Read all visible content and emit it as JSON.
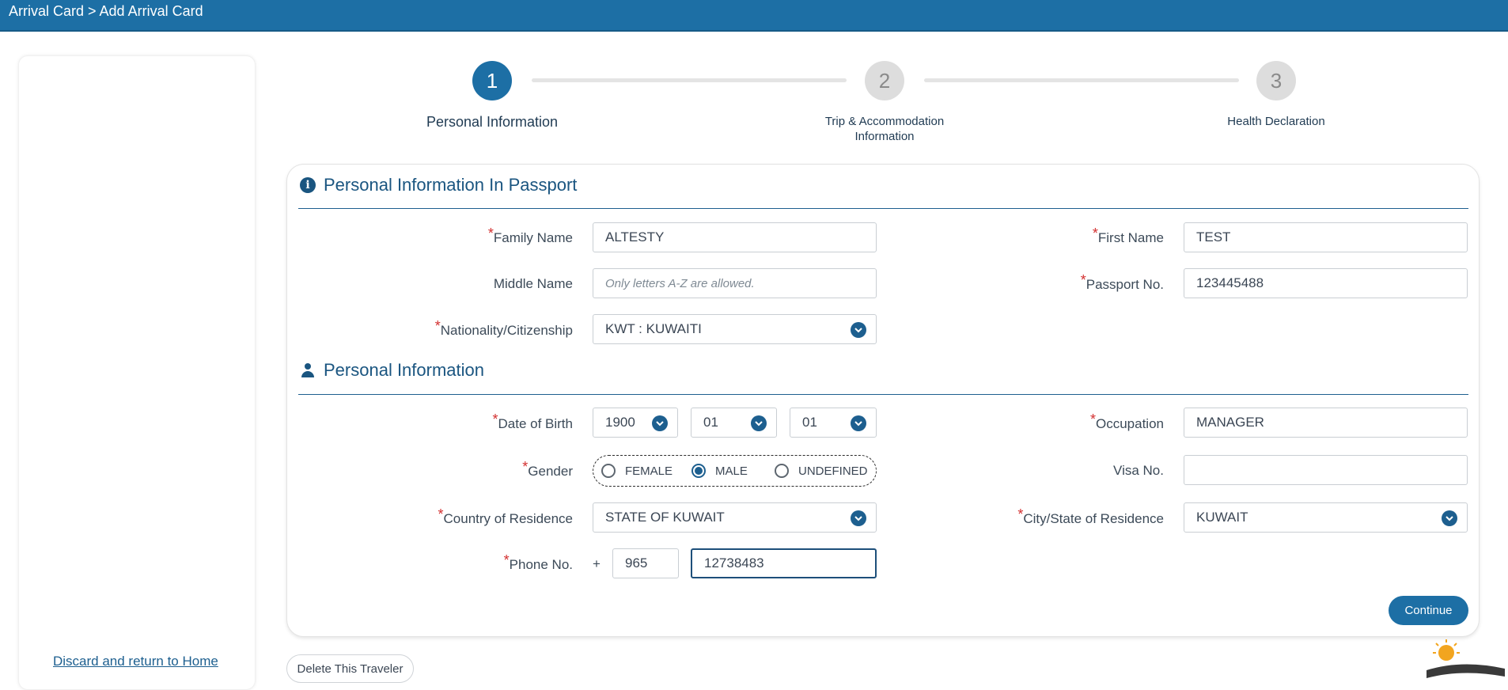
{
  "header": {
    "breadcrumb": "Arrival Card > Add Arrival Card"
  },
  "sidebar": {
    "discard_link": "Discard and return to Home"
  },
  "stepper": {
    "steps": [
      {
        "number": "1",
        "label": "Personal Information",
        "active": true
      },
      {
        "number": "2",
        "label_line1": "Trip & Accommodation",
        "label_line2": "Information",
        "active": false
      },
      {
        "number": "3",
        "label": "Health Declaration",
        "active": false
      }
    ]
  },
  "passport_section": {
    "title": "Personal Information In Passport",
    "family_name": {
      "label": "Family Name",
      "value": "ALTESTY",
      "required": true
    },
    "first_name": {
      "label": "First Name",
      "value": "TEST",
      "required": true
    },
    "middle_name": {
      "label": "Middle Name",
      "placeholder": "Only letters A-Z are allowed.",
      "value": "",
      "required": false
    },
    "passport_no": {
      "label": "Passport No.",
      "value": "123445488",
      "required": true
    },
    "nationality": {
      "label": "Nationality/Citizenship",
      "value": "KWT : KUWAITI",
      "required": true
    }
  },
  "personal_section": {
    "title": "Personal Information",
    "date_of_birth": {
      "label": "Date of Birth",
      "year": "1900",
      "month": "01",
      "day": "01",
      "required": true
    },
    "occupation": {
      "label": "Occupation",
      "value": "MANAGER",
      "required": true
    },
    "gender": {
      "label": "Gender",
      "required": true,
      "options": [
        "FEMALE",
        "MALE",
        "UNDEFINED"
      ],
      "selected": "MALE"
    },
    "visa_no": {
      "label": "Visa No.",
      "value": "",
      "required": false
    },
    "country_of_residence": {
      "label": "Country of Residence",
      "value": "STATE OF KUWAIT",
      "required": true
    },
    "city_of_residence": {
      "label": "City/State of Residence",
      "value": "KUWAIT",
      "required": true
    },
    "phone": {
      "label": "Phone No.",
      "plus": "+",
      "country_code": "965",
      "number": "12738483",
      "required": true
    }
  },
  "actions": {
    "continue_label": "Continue",
    "delete_label": "Delete This Traveler"
  },
  "required_marker": "*",
  "colors": {
    "primary": "#1d6fa5",
    "required": "#d32f2f"
  }
}
